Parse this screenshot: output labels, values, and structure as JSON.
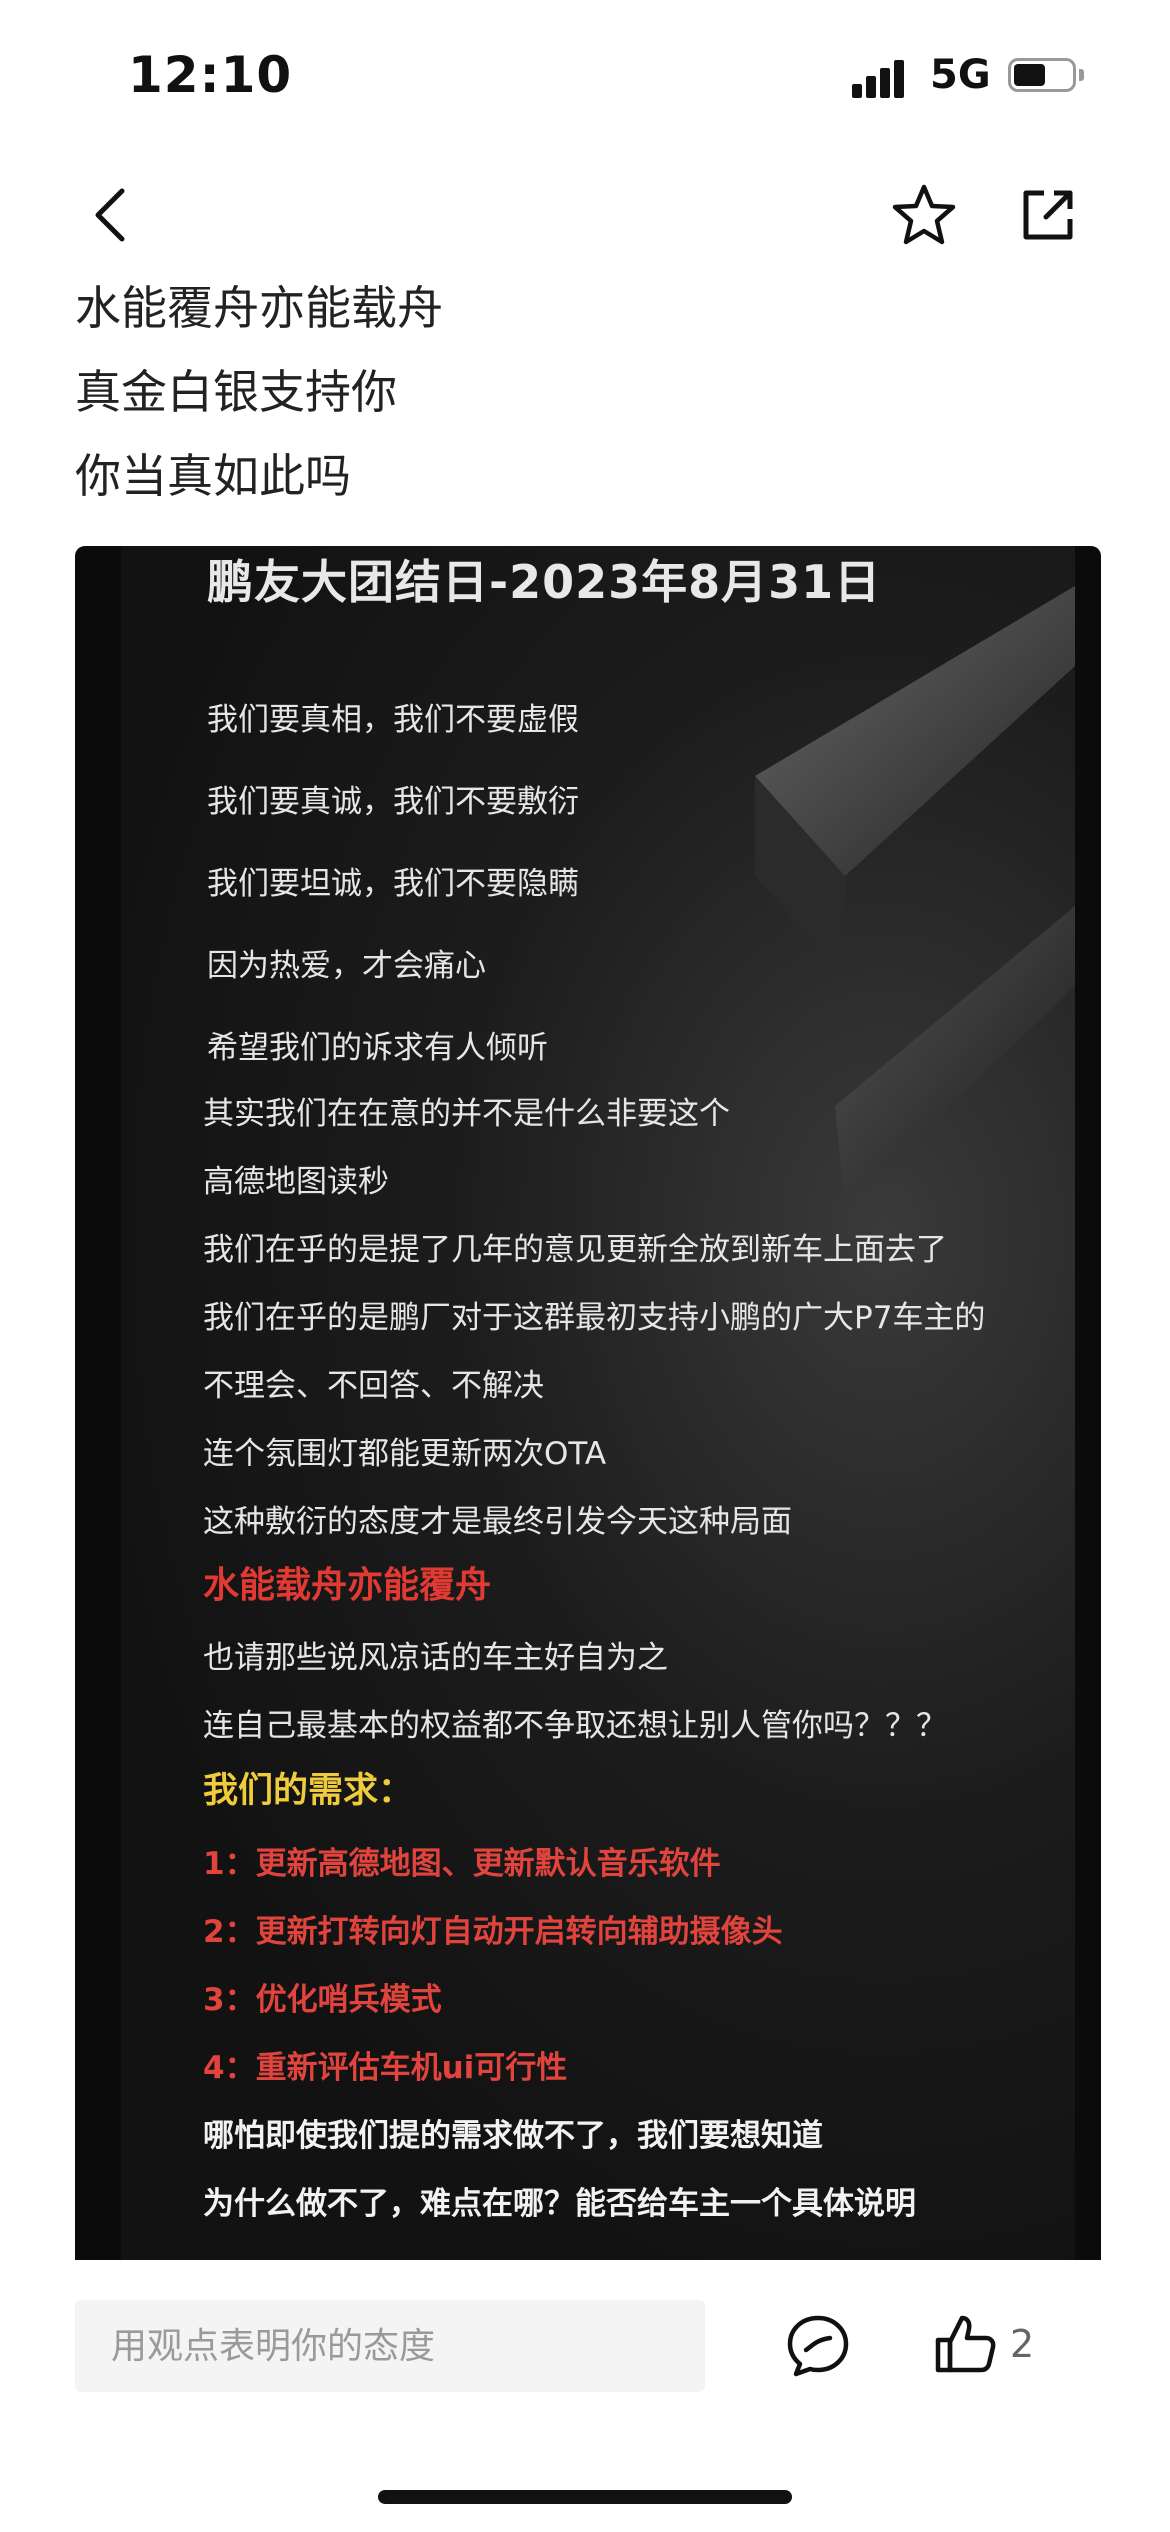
{
  "status_bar": {
    "time": "12:10",
    "network": "5G",
    "battery_level": 0.55
  },
  "nav": {
    "back_icon": "chevron-left-icon",
    "favorite_icon": "star-outline-icon",
    "share_icon": "share-external-icon"
  },
  "post": {
    "lines": [
      "水能覆舟亦能载舟",
      "真金白银支持你",
      "你当真如此吗"
    ]
  },
  "image": {
    "title": "鹏友大团结日-2023年8月31日",
    "lines": [
      "我们要真相，我们不要虚假",
      "我们要真诚，我们不要敷衍",
      "我们要坦诚，我们不要隐瞒",
      "因为热爱，才会痛心",
      "希望我们的诉求有人倾听",
      "其实我们在在意的并不是什么非要这个",
      "高德地图读秒",
      "我们在乎的是提了几年的意见更新全放到新车上面去了",
      "我们在乎的是鹏厂对于这群最初支持小鹏的广大P7车主的",
      "不理会、不回答、不解决",
      "连个氛围灯都能更新两次OTA",
      "这种敷衍的态度才是最终引发今天这种局面",
      "水能载舟亦能覆舟",
      "也请那些说风凉话的车主好自为之",
      "连自己最基本的权益都不争取还想让别人管你吗？？？",
      "我们的需求：",
      "1：更新高德地图、更新默认音乐软件",
      "2：更新打转向灯自动开启转向辅助摄像头",
      "3：优化哨兵模式",
      "4：重新评估车机ui可行性",
      "哪怕即使我们提的需求做不了，我们要想知道",
      "为什么做不了，难点在哪？能否给车主一个具体说明"
    ]
  },
  "bottom": {
    "comment_placeholder": "用观点表明你的态度",
    "like_count": "2",
    "chat_icon": "comment-bubble-icon",
    "like_icon": "thumbs-up-icon"
  }
}
